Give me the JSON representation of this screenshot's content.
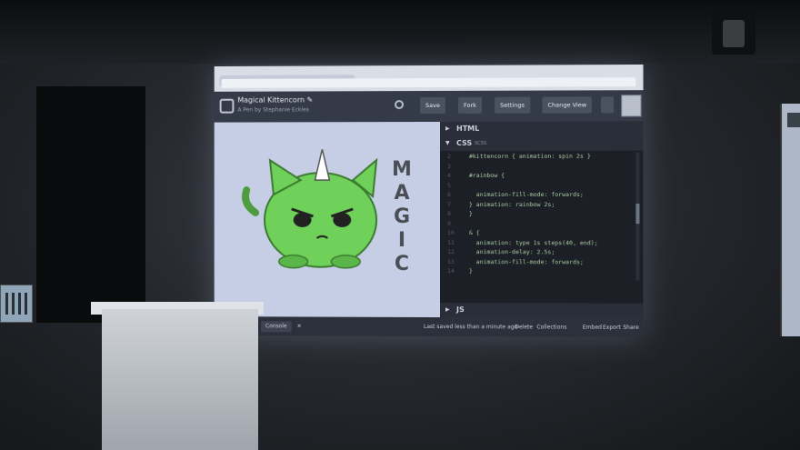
{
  "pen": {
    "title": "Magical Kittencorn ✎",
    "author": "A Pen by Stephanie Eckles"
  },
  "toolbar": {
    "save": "Save",
    "fork": "Fork",
    "settings": "Settings",
    "change_view": "Change View"
  },
  "preview": {
    "magic_letters": [
      "M",
      "A",
      "G",
      "I",
      "C"
    ],
    "cat_color": "#6fd05a"
  },
  "panes": {
    "html": "HTML",
    "css": "CSS",
    "css_sub": "SCSS",
    "js": "JS"
  },
  "code_lines": [
    "  #kittencorn { animation: spin 2s }",
    "",
    "  #rainbow {",
    "",
    "    animation-fill-mode: forwards;",
    "  } animation: rainbow 2s;",
    "  }",
    "",
    "  & {",
    "    animation: type 1s steps(40, end);",
    "    animation-delay: 2.5s;",
    "    animation-fill-mode: forwards;",
    "  }"
  ],
  "status": {
    "console": "Console",
    "close": "✕",
    "saved": "Last saved less than a minute ago",
    "delete": "Delete",
    "collections": "Collections",
    "embed": "Embed",
    "export": "Export",
    "share": "Share"
  },
  "colors": {
    "screen_bg": "#c7d0e6",
    "editor_dark": "#1d1f27",
    "code_text": "#a8cfa2"
  }
}
